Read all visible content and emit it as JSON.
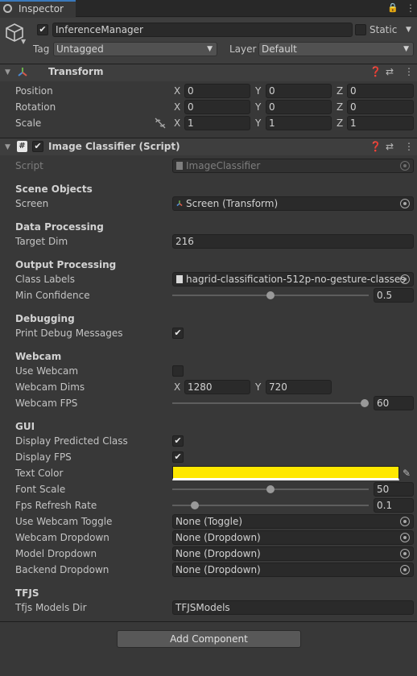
{
  "tab": {
    "title": "Inspector"
  },
  "header": {
    "name": "InferenceManager",
    "static_label": "Static",
    "tag_label": "Tag",
    "tag_value": "Untagged",
    "layer_label": "Layer",
    "layer_value": "Default"
  },
  "transform": {
    "title": "Transform",
    "position_label": "Position",
    "rotation_label": "Rotation",
    "scale_label": "Scale",
    "position": {
      "x": "0",
      "y": "0",
      "z": "0"
    },
    "rotation": {
      "x": "0",
      "y": "0",
      "z": "0"
    },
    "scale": {
      "x": "1",
      "y": "1",
      "z": "1"
    },
    "axis_x": "X",
    "axis_y": "Y",
    "axis_z": "Z"
  },
  "component": {
    "title": "Image Classifier (Script)",
    "script_label": "Script",
    "script_value": "ImageClassifier",
    "scene_objects": "Scene Objects",
    "screen_label": "Screen",
    "screen_value": "Screen (Transform)",
    "data_processing": "Data Processing",
    "target_dim_label": "Target Dim",
    "target_dim_value": "216",
    "output_processing": "Output Processing",
    "class_labels_label": "Class Labels",
    "class_labels_value": "hagrid-classification-512p-no-gesture-classes",
    "min_conf_label": "Min Confidence",
    "min_conf_value": "0.5",
    "min_conf_fraction": 0.5,
    "debugging": "Debugging",
    "print_debug_label": "Print Debug Messages",
    "print_debug_checked": true,
    "webcam": "Webcam",
    "use_webcam_label": "Use Webcam",
    "use_webcam_checked": false,
    "webcam_dims_label": "Webcam Dims",
    "webcam_dims_x": "1280",
    "webcam_dims_y": "720",
    "webcam_fps_label": "Webcam FPS",
    "webcam_fps_value": "60",
    "webcam_fps_fraction": 1.0,
    "gui": "GUI",
    "display_pred_label": "Display Predicted Class",
    "display_pred_checked": true,
    "display_fps_label": "Display FPS",
    "display_fps_checked": true,
    "text_color_label": "Text Color",
    "text_color": "#ffe800",
    "font_scale_label": "Font Scale",
    "font_scale_value": "50",
    "font_scale_fraction": 0.5,
    "fps_refresh_label": "Fps Refresh Rate",
    "fps_refresh_value": "0.1",
    "fps_refresh_fraction": 0.1,
    "use_webcam_toggle_label": "Use Webcam Toggle",
    "use_webcam_toggle_value": "None (Toggle)",
    "webcam_dropdown_label": "Webcam Dropdown",
    "webcam_dropdown_value": "None (Dropdown)",
    "model_dropdown_label": "Model Dropdown",
    "model_dropdown_value": "None (Dropdown)",
    "backend_dropdown_label": "Backend Dropdown",
    "backend_dropdown_value": "None (Dropdown)",
    "tfjs": "TFJS",
    "tfjs_dir_label": "Tfjs Models Dir",
    "tfjs_dir_value": "TFJSModels"
  },
  "add_component": "Add Component"
}
